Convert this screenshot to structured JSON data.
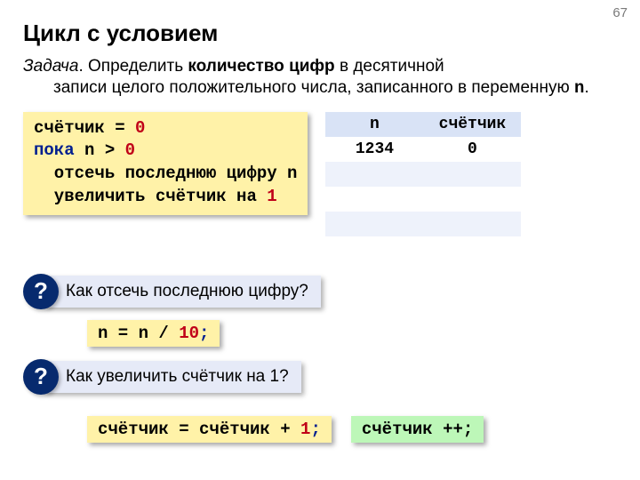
{
  "page_number": "67",
  "title": "Цикл с условием",
  "task": {
    "prefix": "Задача",
    "line1_pre": ". Определить ",
    "bold": "количество цифр",
    "line1_post": " в десятичной",
    "line2": "записи целого положительного числа, записанного в переменную ",
    "var": "n",
    "dot": "."
  },
  "pseudo": {
    "l1a": "счётчик = ",
    "l1b": "0",
    "l2a": "пока",
    "l2b": " n > ",
    "l2c": "0",
    "l3": "  отсечь последнюю цифру n",
    "l4a": "  увеличить счётчик на ",
    "l4b": "1"
  },
  "table": {
    "h1": "n",
    "h2": "счётчик",
    "r1c1": "1234",
    "r1c2": "0"
  },
  "q1": "Как отсечь последнюю цифру?",
  "snip1": {
    "a": "n = n / ",
    "b": "10",
    "c": ";"
  },
  "q2": "Как увеличить счётчик на 1?",
  "snip2": {
    "a": "счётчик = счётчик + ",
    "b": "1",
    "c": ";"
  },
  "snip3": {
    "a": "счётчик ++;"
  },
  "qmark": "?"
}
